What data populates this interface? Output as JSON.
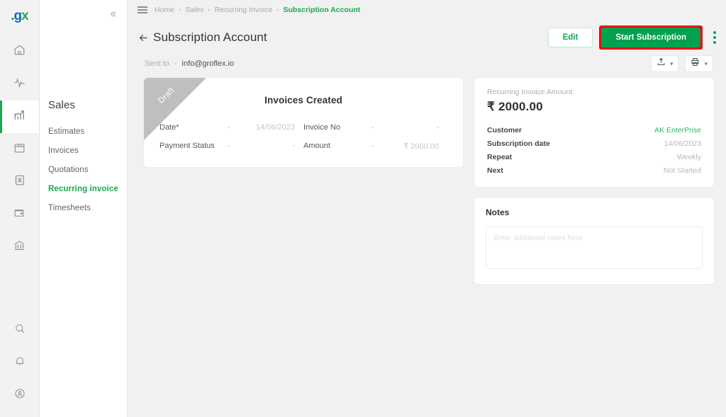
{
  "brand": {
    "logo_dot": ".",
    "logo_g": "g",
    "logo_x": "x"
  },
  "rail": {
    "items": [
      {
        "name": "home-icon",
        "label": "Home"
      },
      {
        "name": "activity-icon",
        "label": "Activity"
      },
      {
        "name": "reports-chart-icon",
        "label": "Sales",
        "active": true
      },
      {
        "name": "inventory-box-icon",
        "label": "Inventory"
      },
      {
        "name": "contacts-book-icon",
        "label": "Contacts"
      },
      {
        "name": "wallet-icon",
        "label": "Expenses"
      },
      {
        "name": "bank-icon",
        "label": "Banking"
      }
    ],
    "bottom": [
      {
        "name": "search-icon",
        "label": "Search"
      },
      {
        "name": "bell-icon",
        "label": "Notifications"
      },
      {
        "name": "user-account-icon",
        "label": "Account"
      }
    ]
  },
  "sidebar": {
    "collapse_icon": "chevron-double-left-icon",
    "title": "Sales",
    "items": [
      {
        "label": "Estimates",
        "active": false
      },
      {
        "label": "Invoices",
        "active": false
      },
      {
        "label": "Quotations",
        "active": false
      },
      {
        "label": "Recurring invoice",
        "active": true
      },
      {
        "label": "Timesheets",
        "active": false
      }
    ]
  },
  "breadcrumb": {
    "menu_icon": "hamburger-menu-icon",
    "items": [
      "Home",
      "Sales",
      "Recurring Invoice",
      "Subscription Account"
    ],
    "separator": "•"
  },
  "header": {
    "back_icon": "arrow-left-icon",
    "title": "Subscription Account",
    "edit_label": "Edit",
    "start_label": "Start Subscription",
    "kebab_icon": "more-vertical-icon"
  },
  "sent_to": {
    "label": "Sent to",
    "dash": "-",
    "email": "info@groflex.io",
    "export_icon": "upload-export-icon",
    "print_icon": "printer-icon",
    "chevron": "▾"
  },
  "invoice_card": {
    "ribbon": "Draft",
    "title": "Invoices Created",
    "rows": [
      [
        {
          "label": "Date*",
          "dash": "-",
          "value": "14/06/2023"
        },
        {
          "label": "Invoice No",
          "dash": "-",
          "value": "-"
        }
      ],
      [
        {
          "label": "Payment Status",
          "dash": "-",
          "value": "-"
        },
        {
          "label": "Amount",
          "dash": "-",
          "value": "₹ 2000.00"
        }
      ]
    ]
  },
  "summary": {
    "caption": "Recurring Invoice Amount:",
    "amount": "₹ 2000.00",
    "rows": [
      {
        "key": "Customer",
        "value": "AK EnterPrise",
        "green": true
      },
      {
        "key": "Subscription date",
        "value": "14/06/2023",
        "green": false
      },
      {
        "key": "Repeat",
        "value": "Weekly",
        "green": false
      },
      {
        "key": "Next",
        "value": "Not Started",
        "green": false
      }
    ]
  },
  "notes": {
    "title": "Notes",
    "placeholder": "Enter additional notes here",
    "value": ""
  },
  "colors": {
    "brand_green": "#16a94d",
    "button_green": "#00a14f",
    "highlight_red": "#fb0007",
    "background": "#f1f1f1"
  }
}
